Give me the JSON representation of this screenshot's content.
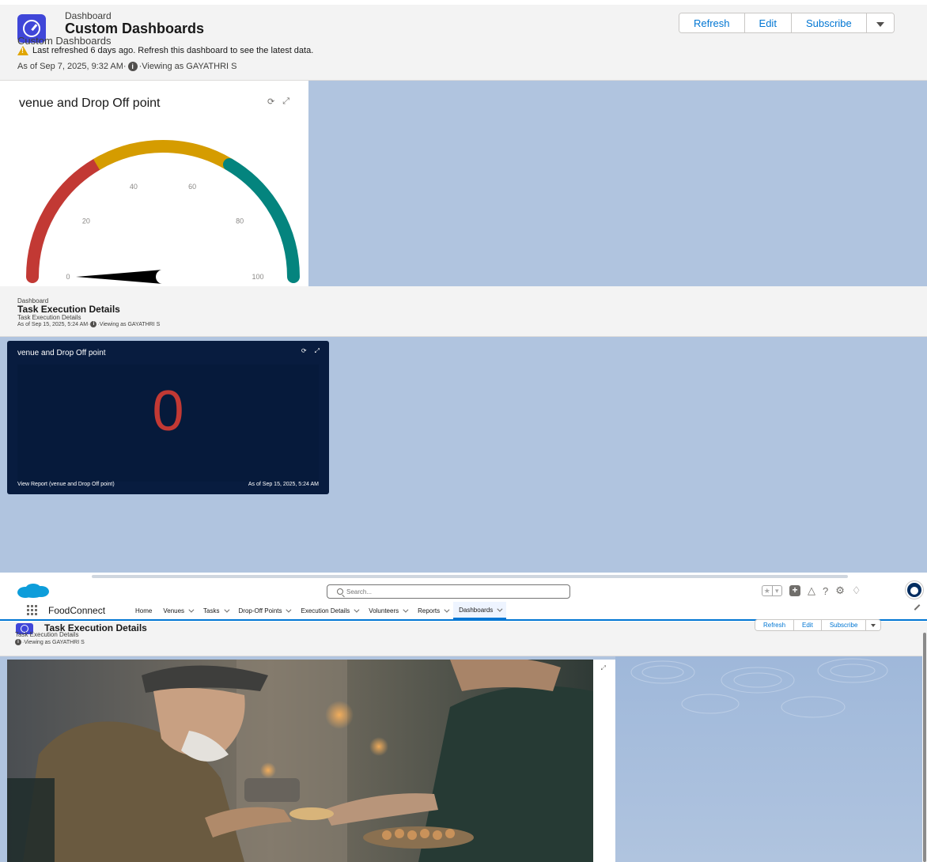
{
  "section1": {
    "eyebrow": "Dashboard",
    "title": "Custom Dashboards",
    "subtitle": "Custom Dashboards",
    "warning": "Last refreshed 6 days ago. Refresh this dashboard to see the latest data.",
    "as_of": "As of Sep 7, 2025, 9:32 AM·",
    "viewing": "·Viewing as GAYATHRI S",
    "buttons": {
      "refresh": "Refresh",
      "edit": "Edit",
      "subscribe": "Subscribe"
    },
    "gauge_card": {
      "title": "venue and Drop Off point",
      "ticks": [
        "0",
        "20",
        "40",
        "60",
        "80",
        "100"
      ]
    }
  },
  "section2": {
    "eyebrow": "Dashboard",
    "title": "Task Execution Details",
    "subtitle": "Task Execution Details",
    "as_of": "As of Sep 15, 2025, 5:24 AM·",
    "viewing": "·Viewing as GAYATHRI S",
    "metric_card": {
      "title": "venue and Drop Off point",
      "value": "0",
      "view_report": "View Report (venue and Drop Off point)",
      "as_of": "As of Sep 15, 2025, 5:24 AM"
    }
  },
  "section3": {
    "search_placeholder": "Search...",
    "app_name": "FoodConnect",
    "nav_items": [
      {
        "label": "Home",
        "has_menu": false
      },
      {
        "label": "Venues",
        "has_menu": true
      },
      {
        "label": "Tasks",
        "has_menu": true
      },
      {
        "label": "Drop-Off Points",
        "has_menu": true
      },
      {
        "label": "Execution Details",
        "has_menu": true
      },
      {
        "label": "Volunteers",
        "has_menu": true
      },
      {
        "label": "Reports",
        "has_menu": true
      },
      {
        "label": "Dashboards",
        "has_menu": true,
        "active": true
      }
    ],
    "title": "Task Execution Details",
    "subtitle": "Task Execution Details",
    "viewing": "·Viewing as GAYATHRI S",
    "buttons": {
      "refresh": "Refresh",
      "edit": "Edit",
      "subscribe": "Subscribe"
    }
  },
  "chart_data": {
    "type": "gauge",
    "value": 0,
    "min": 0,
    "max": 100,
    "ticks": [
      0,
      20,
      40,
      60,
      80,
      100
    ],
    "bands": [
      {
        "from": 0,
        "to": 33,
        "color": "#c23934"
      },
      {
        "from": 33,
        "to": 67,
        "color": "#d59c00"
      },
      {
        "from": 67,
        "to": 100,
        "color": "#04847e"
      }
    ]
  },
  "colors": {
    "brand_blue": "#0176d3",
    "dashboard_bg": "#b0c4df",
    "metric_card_bg": "#081c3f",
    "metric_value": "#c23934",
    "warning": "#e0a500"
  }
}
